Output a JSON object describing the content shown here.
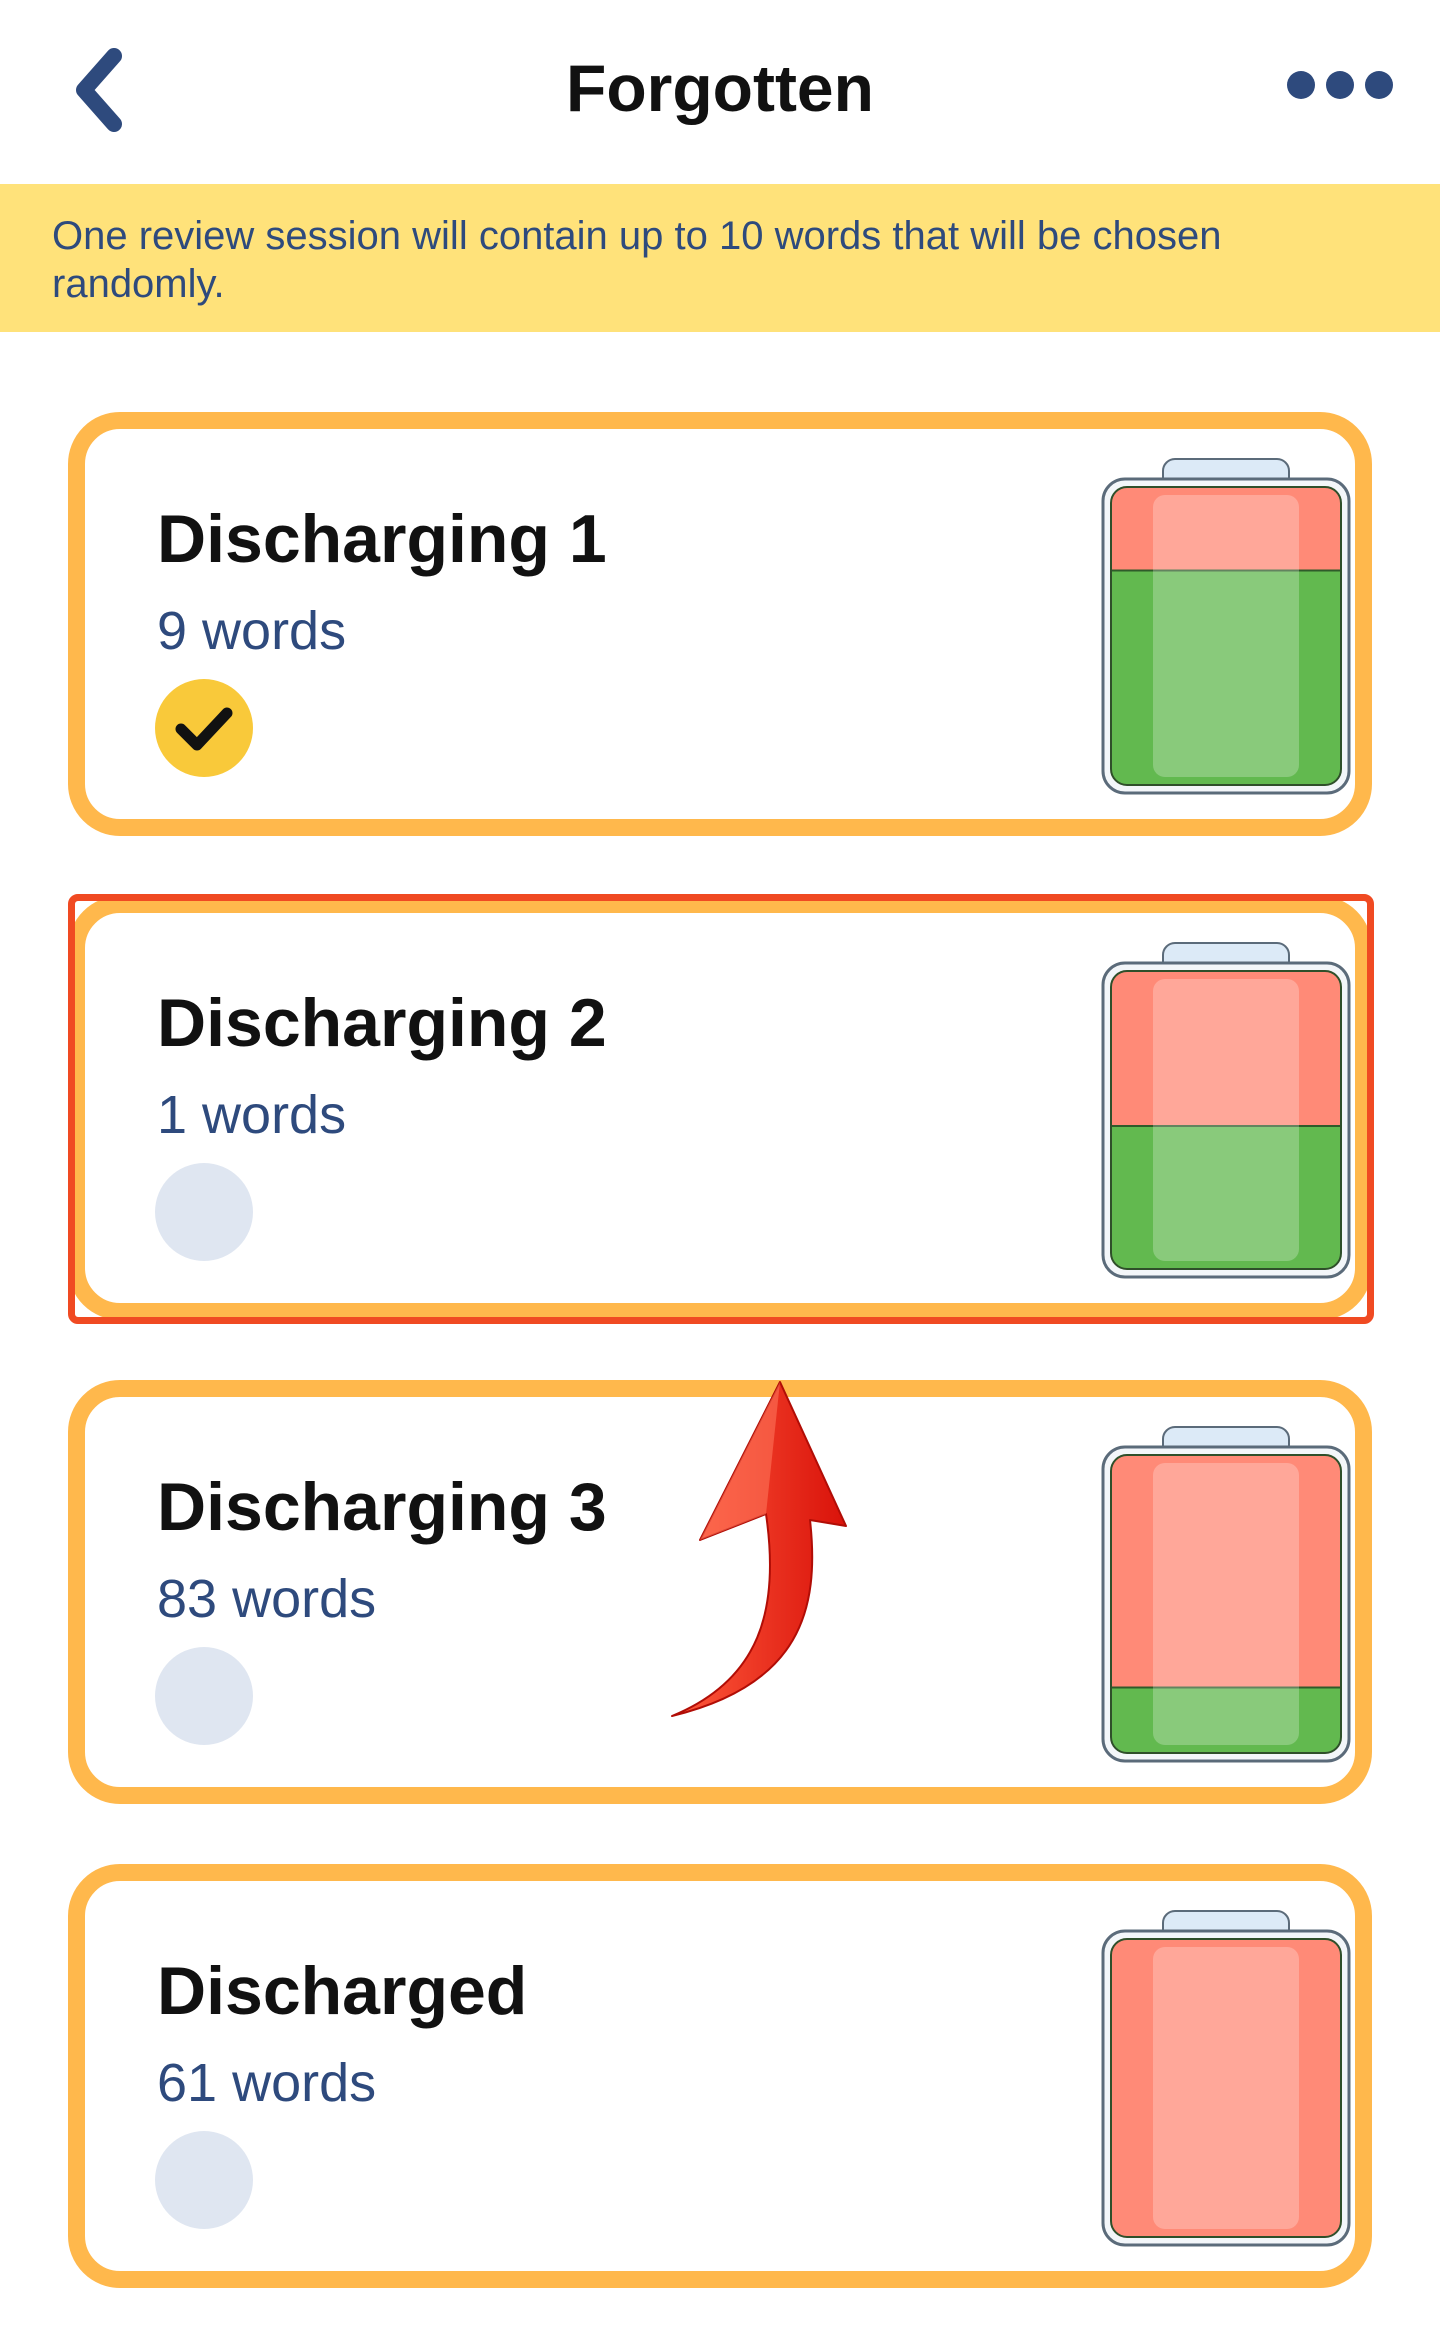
{
  "header": {
    "title": "Forgotten",
    "back_icon": "chevron-left-icon",
    "more_icon": "more-horizontal-icon"
  },
  "banner": {
    "text": "One review session will contain up to 10 words that will be chosen randomly."
  },
  "colors": {
    "accent_orange": "#FFB84C",
    "banner_yellow": "#FFE27A",
    "text_blue": "#2E4A7D",
    "highlight_red": "#F04A22",
    "battery_green": "#62B94F",
    "battery_red": "#FF8A77",
    "check_yellow": "#F9C93A",
    "check_off": "#DFE6F1"
  },
  "cards": [
    {
      "title": "Discharging 1",
      "count": "9 words",
      "selected": true,
      "charge": 0.72
    },
    {
      "title": "Discharging 2",
      "count": "1 words",
      "selected": false,
      "charge": 0.48
    },
    {
      "title": "Discharging 3",
      "count": "83 words",
      "selected": false,
      "charge": 0.22
    },
    {
      "title": "Discharged",
      "count": "61 words",
      "selected": false,
      "charge": 0.0
    }
  ]
}
